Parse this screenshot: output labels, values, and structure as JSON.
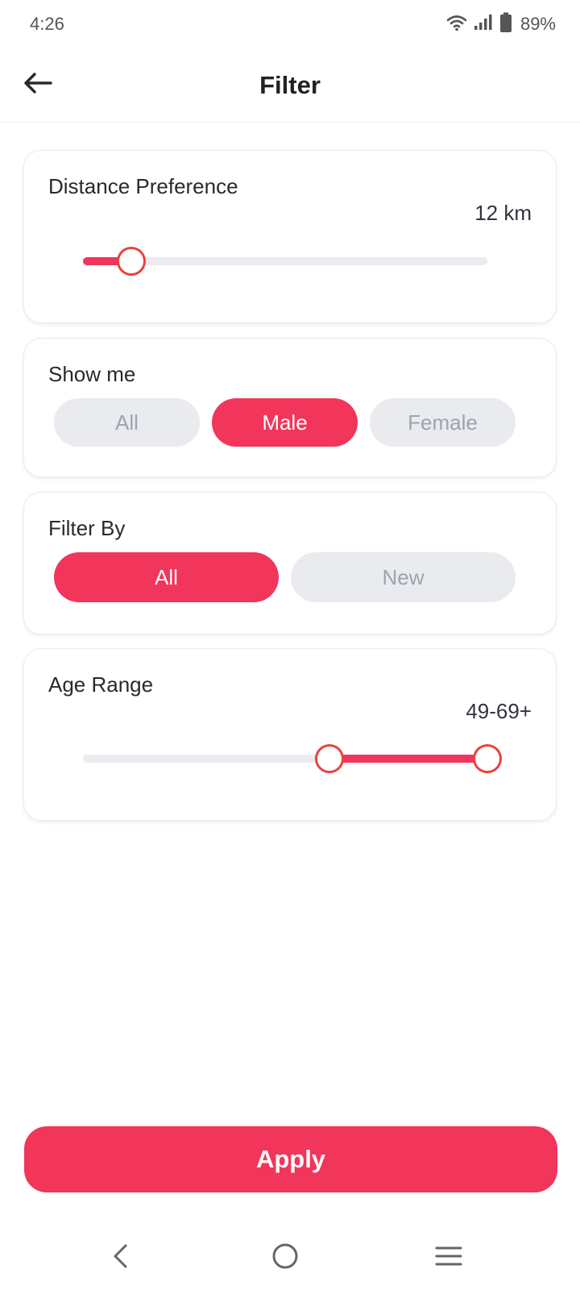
{
  "status_bar": {
    "time": "4:26",
    "battery_percent": "89%",
    "icons": [
      "wifi-icon",
      "signal-icon",
      "battery-icon"
    ]
  },
  "header": {
    "title": "Filter",
    "back_icon": "arrow-left-icon"
  },
  "distance": {
    "title": "Distance Preference",
    "value": "12 km",
    "slider_fill_fraction": 0.12
  },
  "show_me": {
    "title": "Show me",
    "options": [
      "All",
      "Male",
      "Female"
    ],
    "selected": "Male"
  },
  "filter_by": {
    "title": "Filter By",
    "options": [
      "All",
      "New"
    ],
    "selected": "All"
  },
  "age_range": {
    "title": "Age Range",
    "value": "49-69+",
    "range_start_fraction": 0.61,
    "range_end_fraction": 1.0
  },
  "apply_label": "Apply",
  "nav_bar": {
    "icons": [
      "nav-back-icon",
      "nav-home-icon",
      "nav-menu-icon"
    ]
  },
  "colors": {
    "accent": "#f2355a",
    "thumb_border": "#e8433f",
    "chip_inactive_bg": "#eaebef",
    "chip_inactive_text": "#9ea3b0",
    "track": "#ebebf0"
  }
}
